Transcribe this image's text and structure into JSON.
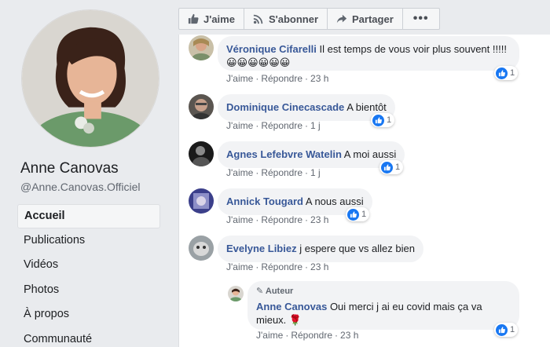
{
  "profile": {
    "name": "Anne Canovas",
    "handle": "@Anne.Canovas.Officiel"
  },
  "nav": [
    {
      "label": "Accueil",
      "active": true
    },
    {
      "label": "Publications"
    },
    {
      "label": "Vidéos"
    },
    {
      "label": "Photos"
    },
    {
      "label": "À propos"
    },
    {
      "label": "Communauté"
    }
  ],
  "toolbar": {
    "like": "J'aime",
    "subscribe": "S'abonner",
    "share": "Partager",
    "more": "•••"
  },
  "comments": [
    {
      "author": "Véronique Cifarelli",
      "text": "Il est temps de vous voir plus souvent !!!!!",
      "emojis": "😀😀😀😀😀😀",
      "like": "J'aime",
      "reply": "Répondre",
      "time": "23 h",
      "reactions": "1"
    },
    {
      "author": "Dominique Cinecascade",
      "text": "A bientôt",
      "like": "J'aime",
      "reply": "Répondre",
      "time": "1 j",
      "reactions": "1"
    },
    {
      "author": "Agnes Lefebvre Watelin",
      "text": "A moi aussi",
      "like": "J'aime",
      "reply": "Répondre",
      "time": "1 j",
      "reactions": "1"
    },
    {
      "author": "Annick Tougard",
      "text": "A nous aussi",
      "like": "J'aime",
      "reply": "Répondre",
      "time": "23 h",
      "reactions": "1"
    },
    {
      "author": "Evelyne Libiez",
      "text": "j espere que vs allez bien",
      "like": "J'aime",
      "reply": "Répondre",
      "time": "23 h"
    }
  ],
  "reply": {
    "badge": "Auteur",
    "author": "Anne Canovas",
    "text": "Oui merci j ai eu covid mais ça va mieux.",
    "emoji": "🌹",
    "like": "J'aime",
    "reply": "Répondre",
    "time": "23 h",
    "reactions": "1"
  },
  "colors": {
    "link": "#385898",
    "like_blue": "#1877f2",
    "bubble": "#f2f3f5",
    "page_bg": "#e9ebee"
  }
}
